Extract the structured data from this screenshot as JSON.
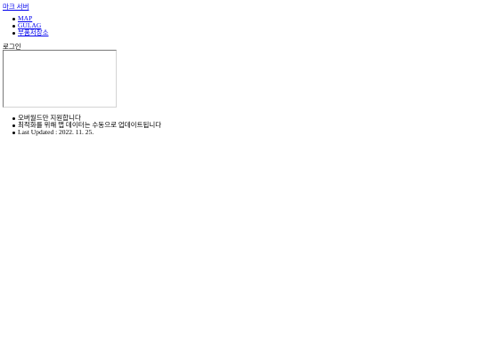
{
  "header": {
    "site_title": "마크 서버"
  },
  "nav": {
    "items": [
      {
        "label": "MAP"
      },
      {
        "label": "GULAG"
      },
      {
        "label": "부품저장소"
      }
    ]
  },
  "login": {
    "label": "로그인"
  },
  "info": {
    "items": [
      {
        "text": "오버월드만 지원합니다"
      },
      {
        "text": "최적화를 위해 맵 데이터는 수동으로 업데이트됩니다"
      },
      {
        "text": "Last Updated : 2022. 11. 25."
      }
    ]
  }
}
